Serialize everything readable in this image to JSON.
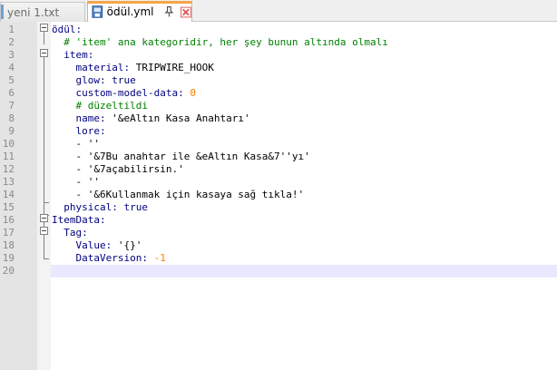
{
  "tabs": [
    {
      "label": "yeni 1.txt",
      "active": false
    },
    {
      "label": "ödül.yml",
      "active": true
    }
  ],
  "icons": {
    "file": "file-icon",
    "pin": "pin-icon",
    "close": "close-icon"
  },
  "colors": {
    "key": "#000080",
    "comment": "#008000",
    "number": "#ff7f00",
    "current_line": "#e8e8ff",
    "active_tab_accent": "#f5a54a",
    "close_icon": "#d9534f"
  },
  "editor": {
    "current_line": 20,
    "lines": [
      {
        "n": "1",
        "indent": "",
        "parts": [
          {
            "t": "ödül:",
            "c": "key"
          }
        ]
      },
      {
        "n": "2",
        "indent": "  ",
        "parts": [
          {
            "t": "# 'item' ana kategoridir, her şey bunun altında olmalı",
            "c": "comment"
          }
        ]
      },
      {
        "n": "3",
        "indent": "  ",
        "parts": [
          {
            "t": "item:",
            "c": "key"
          }
        ]
      },
      {
        "n": "4",
        "indent": "    ",
        "parts": [
          {
            "t": "material:",
            "c": "key"
          },
          {
            "t": " TRIPWIRE_HOOK",
            "c": "str"
          }
        ]
      },
      {
        "n": "5",
        "indent": "    ",
        "parts": [
          {
            "t": "glow:",
            "c": "key"
          },
          {
            "t": " true",
            "c": "key"
          }
        ]
      },
      {
        "n": "6",
        "indent": "    ",
        "parts": [
          {
            "t": "custom-model-data:",
            "c": "key"
          },
          {
            "t": " 0",
            "c": "num"
          }
        ]
      },
      {
        "n": "7",
        "indent": "    ",
        "parts": [
          {
            "t": "# düzeltildi",
            "c": "comment"
          }
        ]
      },
      {
        "n": "8",
        "indent": "    ",
        "parts": [
          {
            "t": "name:",
            "c": "key"
          },
          {
            "t": " '&eAltın Kasa Anahtarı'",
            "c": "str"
          }
        ]
      },
      {
        "n": "9",
        "indent": "    ",
        "parts": [
          {
            "t": "lore:",
            "c": "key"
          }
        ]
      },
      {
        "n": "10",
        "indent": "    ",
        "parts": [
          {
            "t": "- ''",
            "c": "str"
          }
        ]
      },
      {
        "n": "11",
        "indent": "    ",
        "parts": [
          {
            "t": "- '&7Bu anahtar ile &eAltın Kasa&7''yı'",
            "c": "str"
          }
        ]
      },
      {
        "n": "12",
        "indent": "    ",
        "parts": [
          {
            "t": "- '&7açabilirsin.'",
            "c": "str"
          }
        ]
      },
      {
        "n": "13",
        "indent": "    ",
        "parts": [
          {
            "t": "- ''",
            "c": "str"
          }
        ]
      },
      {
        "n": "14",
        "indent": "    ",
        "parts": [
          {
            "t": "- '&6Kullanmak için kasaya sağ tıkla!'",
            "c": "str"
          }
        ]
      },
      {
        "n": "15",
        "indent": "  ",
        "parts": [
          {
            "t": "physical:",
            "c": "key"
          },
          {
            "t": " true",
            "c": "key"
          }
        ]
      },
      {
        "n": "16",
        "indent": "",
        "parts": [
          {
            "t": "ItemData:",
            "c": "key"
          }
        ]
      },
      {
        "n": "17",
        "indent": "  ",
        "parts": [
          {
            "t": "Tag:",
            "c": "key"
          }
        ]
      },
      {
        "n": "18",
        "indent": "    ",
        "parts": [
          {
            "t": "Value:",
            "c": "key"
          },
          {
            "t": " '{}'",
            "c": "str"
          }
        ]
      },
      {
        "n": "19",
        "indent": "    ",
        "parts": [
          {
            "t": "DataVersion:",
            "c": "key"
          },
          {
            "t": " -1",
            "c": "num"
          }
        ]
      },
      {
        "n": "20",
        "indent": "",
        "parts": []
      }
    ]
  }
}
